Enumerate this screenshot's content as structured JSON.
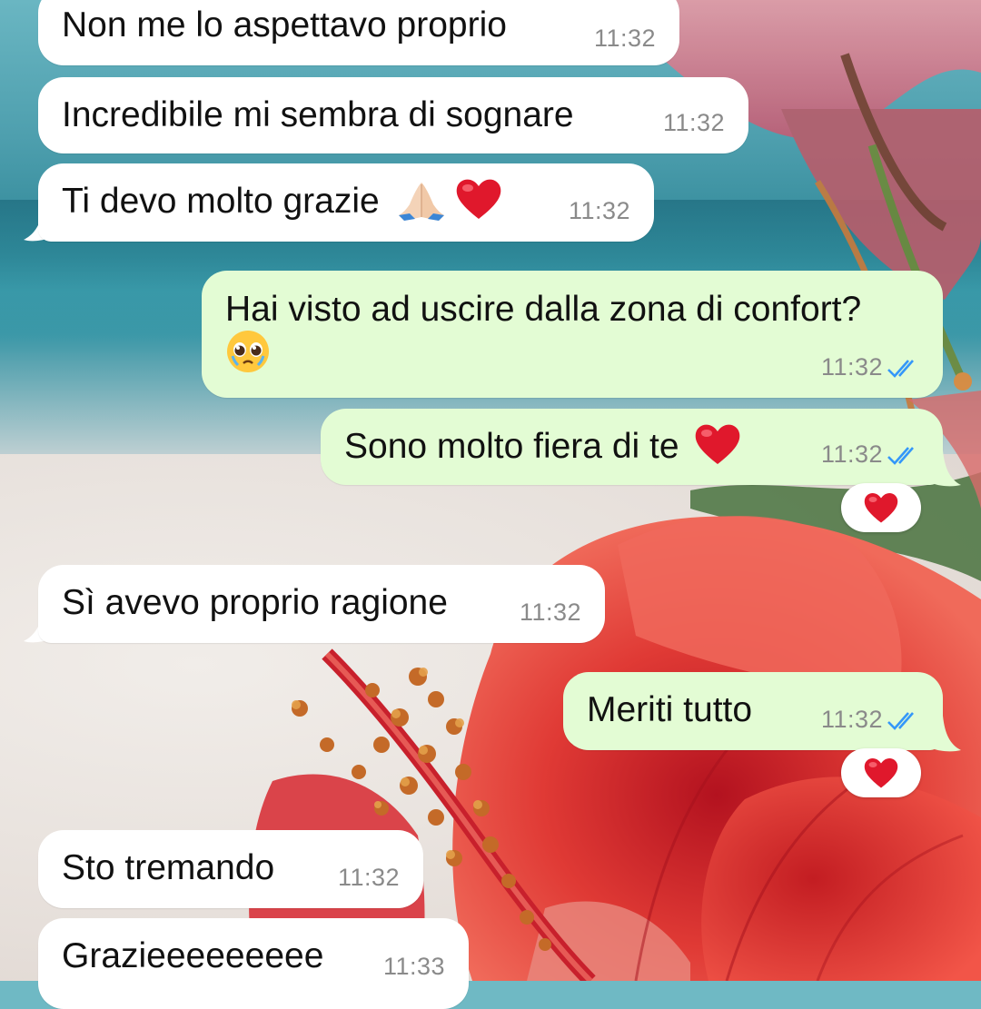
{
  "messages": [
    {
      "direction": "in",
      "text": "Non me lo aspettavo proprio",
      "time": "11:32"
    },
    {
      "direction": "in",
      "text": "Incredibile mi sembra di sognare",
      "time": "11:32"
    },
    {
      "direction": "in",
      "text": "Ti devo molto grazie",
      "emojis": [
        "folded-hands-icon",
        "red-heart-icon"
      ],
      "time": "11:32"
    },
    {
      "direction": "out",
      "text": "Hai visto ad uscire dalla zona di confort?",
      "emojis": [
        "pleading-face-icon"
      ],
      "time": "11:32",
      "status": "read"
    },
    {
      "direction": "out",
      "text": "Sono molto fiera di te",
      "emojis": [
        "red-heart-icon"
      ],
      "time": "11:32",
      "status": "read",
      "reaction": "red-heart-icon"
    },
    {
      "direction": "in",
      "text": "Sì avevo proprio ragione",
      "time": "11:32"
    },
    {
      "direction": "out",
      "text": "Meriti tutto",
      "time": "11:32",
      "status": "read",
      "reaction": "red-heart-icon"
    },
    {
      "direction": "in",
      "text": "Sto tremando",
      "time": "11:32"
    },
    {
      "direction": "in",
      "text": "Grazieeeeeeeee",
      "time": "11:33"
    }
  ],
  "colors": {
    "incoming_bubble": "#ffffff",
    "outgoing_bubble": "#e3fcd4",
    "read_ticks": "#3497f9",
    "timestamp": "#8a8a8a"
  }
}
